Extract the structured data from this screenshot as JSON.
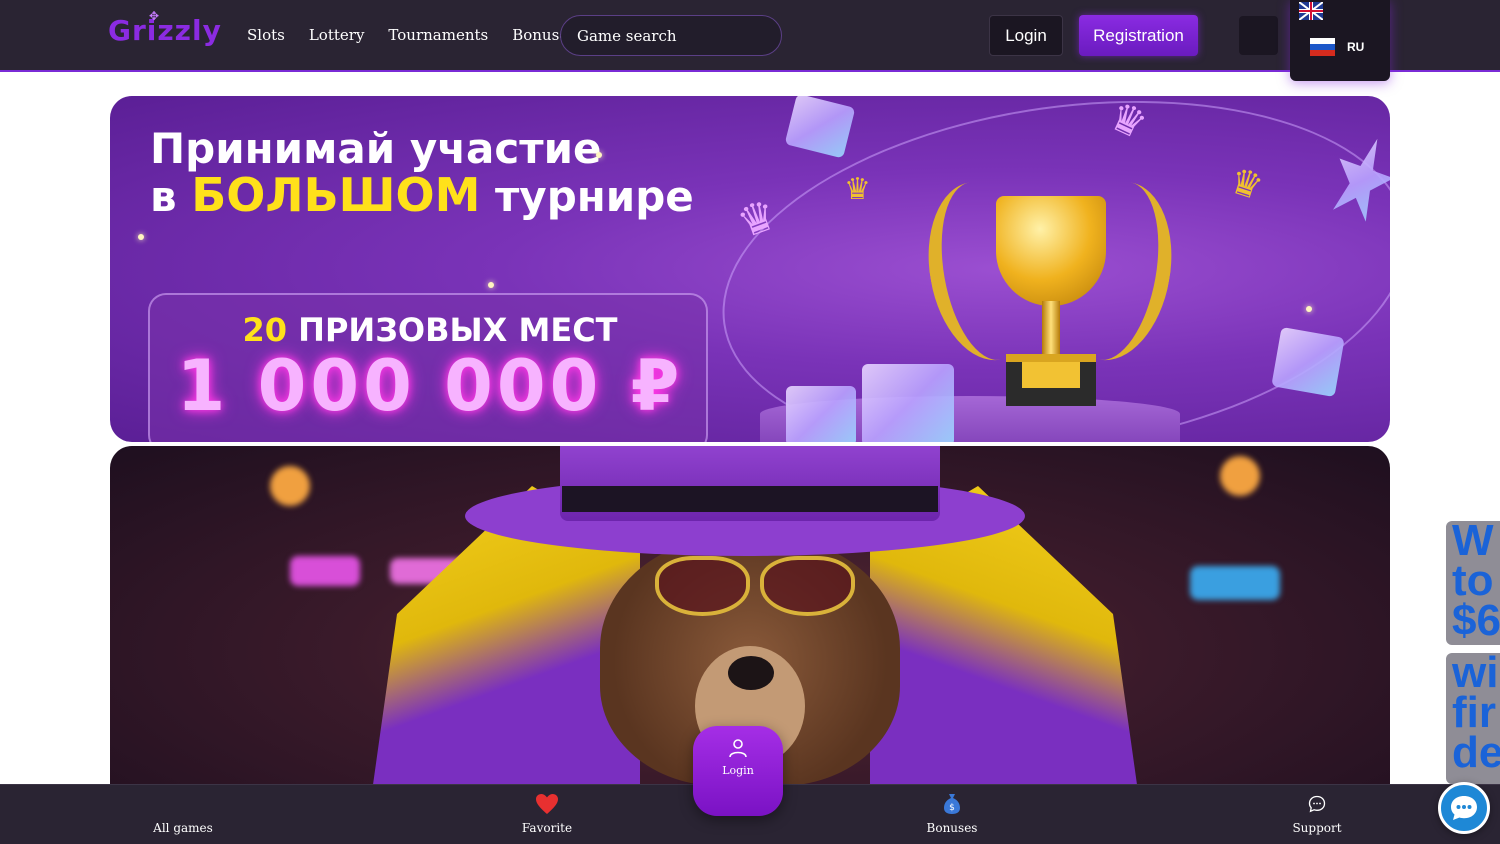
{
  "header": {
    "logo_text": "Grizzly",
    "nav": [
      {
        "label": "Slots"
      },
      {
        "label": "Lottery"
      },
      {
        "label": "Tournaments"
      },
      {
        "label": "Bonuses"
      }
    ],
    "search": {
      "placeholder": "Game search"
    },
    "login_label": "Login",
    "registration_label": "Registration"
  },
  "language_menu": {
    "options": [
      {
        "code": "EN",
        "icon": "uk-flag-icon"
      },
      {
        "code": "RU",
        "icon": "ru-flag-icon"
      }
    ],
    "visible_label": "RU"
  },
  "banners": [
    {
      "line1": "Принимай участие",
      "line2_prefix": "в",
      "line2_highlight": "БОЛЬШОМ",
      "line2_suffix": "турнире",
      "places_number": "20",
      "places_text": "ПРИЗОВЫХ МЕСТ",
      "prize": "1 000 000 ₽"
    },
    {
      "image": "bear-in-purple-hat-illustration"
    }
  ],
  "floating_login": {
    "label": "Login",
    "icon": "user-icon"
  },
  "side_tabs": [
    {
      "text": "W\nto\n$6"
    },
    {
      "text": "wi\nfir\nde"
    }
  ],
  "bottom_nav": [
    {
      "label": "All games",
      "icon": "grid-icon"
    },
    {
      "label": "Favorite",
      "icon": "heart-icon"
    },
    {
      "label": "Bonuses",
      "icon": "money-bag-icon"
    },
    {
      "label": "Support",
      "icon": "chat-bubble-icon"
    }
  ],
  "colors": {
    "header_bg": "#2a2433",
    "accent_purple": "#8a2be2",
    "highlight_yellow": "#ffe11a",
    "chat_blue": "#1e88d6"
  }
}
